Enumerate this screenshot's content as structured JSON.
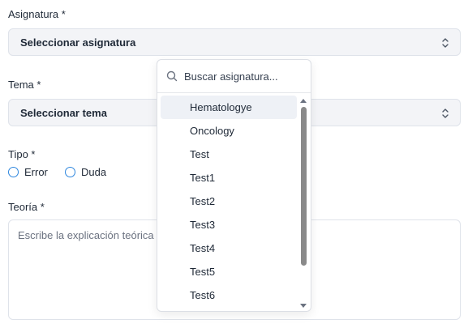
{
  "form": {
    "asignatura_label": "Asignatura *",
    "asignatura_value": "Seleccionar asignatura",
    "tema_label": "Tema *",
    "tema_value": "Seleccionar tema",
    "tipo_label": "Tipo *",
    "tipo_options": [
      "Error",
      "Duda"
    ],
    "teoria_label": "Teoría *",
    "teoria_placeholder": "Escribe la explicación teórica de"
  },
  "dropdown": {
    "search_placeholder": "Buscar asignatura...",
    "highlighted_index": 0,
    "items": [
      "Hematologye",
      "Oncology",
      "Test",
      "Test1",
      "Test2",
      "Test3",
      "Test4",
      "Test5",
      "Test6"
    ]
  },
  "icons": {
    "select_chevron": "chevron-up-down-icon",
    "search": "search-icon",
    "scroll_up": "scroll-up-arrow-icon",
    "scroll_down": "scroll-down-arrow-icon"
  },
  "colors": {
    "radio_border": "#2e86de",
    "select_background": "#f3f4f7",
    "highlight": "#eef1f6"
  }
}
